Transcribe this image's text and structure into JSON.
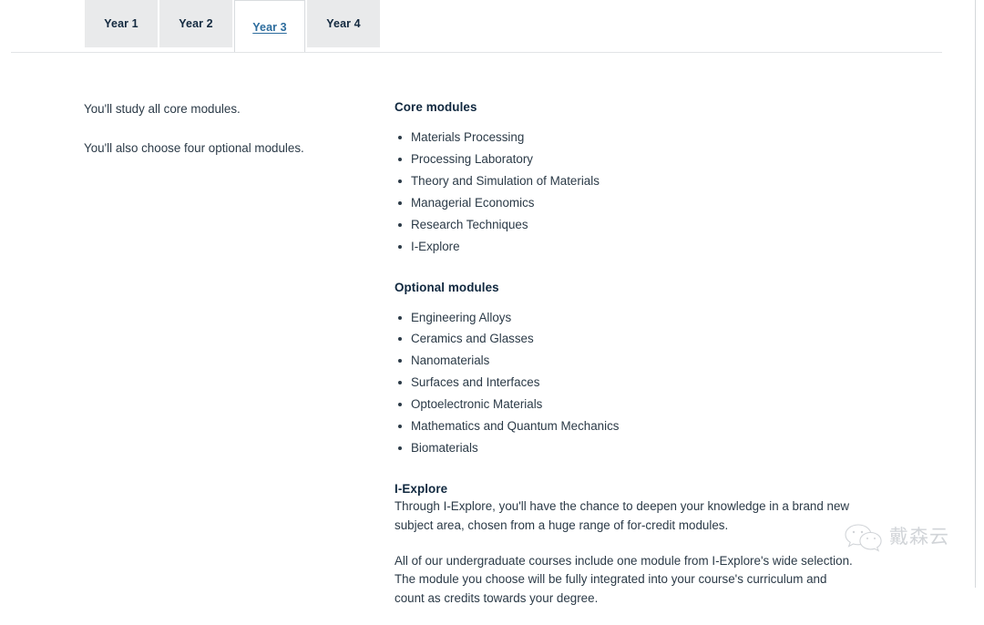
{
  "tabs": [
    {
      "label": "Year 1",
      "active": false
    },
    {
      "label": "Year 2",
      "active": false
    },
    {
      "label": "Year 3",
      "active": true
    },
    {
      "label": "Year 4",
      "active": false
    }
  ],
  "left_column": {
    "paragraph_1": "You'll study all core modules.",
    "paragraph_2": "You'll also choose four optional modules."
  },
  "core_modules": {
    "heading": "Core modules",
    "items": [
      "Materials Processing",
      "Processing Laboratory",
      "Theory and Simulation of Materials",
      "Managerial Economics",
      "Research Techniques",
      "I-Explore"
    ]
  },
  "optional_modules": {
    "heading": "Optional modules",
    "items": [
      "Engineering Alloys",
      "Ceramics and Glasses",
      "Nanomaterials",
      "Surfaces and Interfaces",
      "Optoelectronic Materials",
      "Mathematics and Quantum Mechanics",
      "Biomaterials"
    ]
  },
  "iexplore": {
    "heading": "I-Explore",
    "paragraph_1": "Through I-Explore, you'll have the chance to deepen your knowledge in a brand new subject area, chosen from a huge range of for-credit modules.",
    "paragraph_2": "All of our undergraduate courses include one module from I-Explore's wide selection. The module you choose will be fully integrated into your course's curriculum and count as credits towards your degree."
  },
  "watermark": {
    "text": "戴森云",
    "icon": "wechat-bubble-icon"
  },
  "colors": {
    "link": "#2c6c9d",
    "heading": "#10283f",
    "body": "#2b3a47",
    "tab_inactive_bg": "#e9eaeb",
    "tab_active_bg": "#ffffff",
    "rule": "#e2e4e6"
  }
}
